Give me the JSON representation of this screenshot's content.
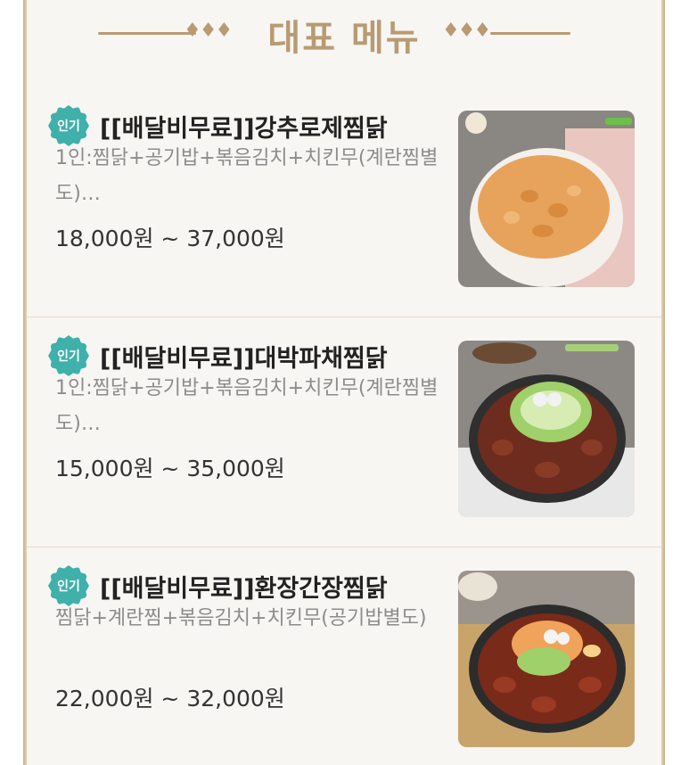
{
  "header": {
    "title": "대표 메뉴",
    "diamonds": "♦♦♦"
  },
  "menu": [
    {
      "badge": "인기",
      "name": "[[배달비무료]]강추로제찜닭",
      "desc": "1인:찜닭+공기밥+볶음김치+치킨무(계란찜별도)…",
      "price": "18,000원 ~ 37,000원"
    },
    {
      "badge": "인기",
      "name": "[[배달비무료]]대박파채찜닭",
      "desc": "1인:찜닭+공기밥+볶음김치+치킨무(계란찜별도)…",
      "price": "15,000원 ~ 35,000원"
    },
    {
      "badge": "인기",
      "name": "[[배달비무료]]환장간장찜닭",
      "desc": "찜닭+계란찜+볶음김치+치킨무(공기밥별도)",
      "price": "22,000원 ~ 32,000원"
    }
  ],
  "colors": {
    "accent": "#b89b72",
    "badge": "#3fb0aa",
    "panel": "#f8f6f3"
  }
}
